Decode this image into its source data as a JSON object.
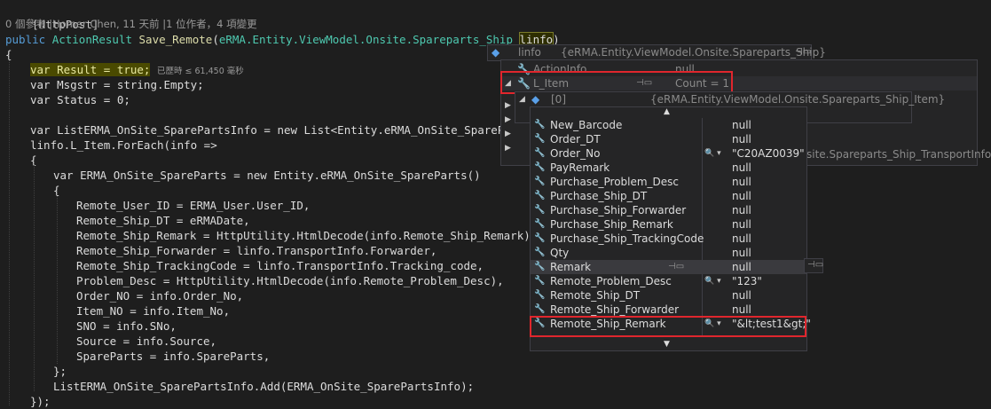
{
  "code": {
    "attribute": "[HttpPost]",
    "codelens": "0 個參考 |Homer Chen, 11 天前 |1 位作者，4 項變更",
    "signature": {
      "kw_public": "public",
      "ret_type": "ActionResult",
      "method": "Save_Remote",
      "param_type": "eRMA.Entity.ViewModel.Onsite.Spareparts_Ship",
      "param_name": "linfo"
    },
    "brace_open": "{",
    "var1": "var Result = true;",
    "elapsed": "已歷時 ≤ 61,450 毫秒",
    "var2": "var Msgstr = string.Empty;",
    "var3": "var Status = 0;",
    "list_decl": "var ListERMA_OnSite_SparePartsInfo = new List<Entity.eRMA_OnSite_SpareParts>();",
    "foreach": "linfo.L_Item.ForEach(info =>",
    "foreach_brace": "{",
    "new_obj": "var ERMA_OnSite_SpareParts = new Entity.eRMA_OnSite_SpareParts()",
    "init_brace": "{",
    "assign1": "Remote_User_ID = ERMA_User.User_ID,",
    "assign2": "Remote_Ship_DT = eRMADate,",
    "assign3": "Remote_Ship_Remark = HttpUtility.HtmlDecode(info.Remote_Ship_Remark),",
    "assign4": "Remote_Ship_Forwarder = linfo.TransportInfo.Forwarder,",
    "assign5": "Remote_Ship_TrackingCode = linfo.TransportInfo.Tracking_code,",
    "assign6": "Problem_Desc = HttpUtility.HtmlDecode(info.Remote_Problem_Desc),",
    "assign7": "Order_NO = info.Order_No,",
    "assign8": "Item_NO = info.Item_No,",
    "assign9": "SNO = info.SNo,",
    "assign10": "Source = info.Source,",
    "assign11": "SpareParts = info.SpareParts,",
    "init_close": "};",
    "add_call": "ListERMA_OnSite_SparePartsInfo.Add(ERMA_OnSite_SparePartsInfo);",
    "foreach_close": "});"
  },
  "datatip_root": {
    "name": "linfo",
    "value": "{eRMA.Entity.ViewModel.Onsite.Spareparts_Ship}"
  },
  "datatip_level1": {
    "rows": [
      {
        "name": "ActionInfo",
        "value": "null"
      },
      {
        "name": "L_Item",
        "value": "Count = 1"
      }
    ],
    "transport_tail": "site.Spareparts_Ship_TransportInfo}"
  },
  "datatip_level2": {
    "name": "[0]",
    "value": "{eRMA.Entity.ViewModel.Onsite.Spareparts_Ship_Item}"
  },
  "datatip_props": {
    "rows": [
      {
        "name": "New_Barcode",
        "value": "null"
      },
      {
        "name": "Order_DT",
        "value": "null"
      },
      {
        "name": "Order_No",
        "value": "\"C20AZ0039\""
      },
      {
        "name": "PayRemark",
        "value": "null"
      },
      {
        "name": "Purchase_Problem_Desc",
        "value": "null"
      },
      {
        "name": "Purchase_Ship_DT",
        "value": "null"
      },
      {
        "name": "Purchase_Ship_Forwarder",
        "value": "null"
      },
      {
        "name": "Purchase_Ship_Remark",
        "value": "null"
      },
      {
        "name": "Purchase_Ship_TrackingCode",
        "value": "null"
      },
      {
        "name": "Qty",
        "value": "null"
      },
      {
        "name": "Remark",
        "value": "null"
      },
      {
        "name": "Remote_Problem_Desc",
        "value": "\"123\""
      },
      {
        "name": "Remote_Ship_DT",
        "value": "null"
      },
      {
        "name": "Remote_Ship_Forwarder",
        "value": "null"
      },
      {
        "name": "Remote_Ship_Remark",
        "value": "\"&lt;test1&gt;\""
      }
    ]
  },
  "colors": {
    "background": "#1e1e1e",
    "highlight_red": "#e0262d",
    "keyword": "#569cd6",
    "type": "#4ec9b0",
    "method": "#dcdcaa"
  }
}
